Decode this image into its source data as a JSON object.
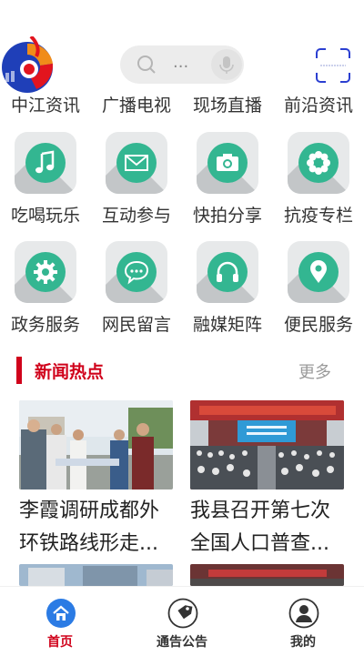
{
  "header": {
    "search_placeholder": "...",
    "logo_name": "app-logo",
    "accent": "#d0021b",
    "icon_color": "#33b691"
  },
  "top_links": [
    "中江资讯",
    "广播电视",
    "现场直播",
    "前沿资讯"
  ],
  "grid_row1": [
    {
      "label": "吃喝玩乐",
      "icon": "music-note-icon"
    },
    {
      "label": "互动参与",
      "icon": "envelope-icon"
    },
    {
      "label": "快拍分享",
      "icon": "camera-icon"
    },
    {
      "label": "抗疫专栏",
      "icon": "flower-icon"
    }
  ],
  "grid_row2": [
    {
      "label": "政务服务",
      "icon": "gear-icon"
    },
    {
      "label": "网民留言",
      "icon": "chat-bubble-icon"
    },
    {
      "label": "融媒矩阵",
      "icon": "headphones-icon"
    },
    {
      "label": "便民服务",
      "icon": "location-pin-icon"
    }
  ],
  "news": {
    "section_title": "新闻热点",
    "more_label": "更多",
    "items": [
      {
        "title_line1": "李霞调研成都外",
        "title_line2": "环铁路线形走..."
      },
      {
        "title_line1": "我县召开第七次",
        "title_line2": "全国人口普查..."
      }
    ]
  },
  "tabbar": [
    {
      "label": "首页",
      "icon": "home-icon",
      "active": true
    },
    {
      "label": "通告公告",
      "icon": "tag-icon",
      "active": false
    },
    {
      "label": "我的",
      "icon": "user-icon",
      "active": false
    }
  ]
}
